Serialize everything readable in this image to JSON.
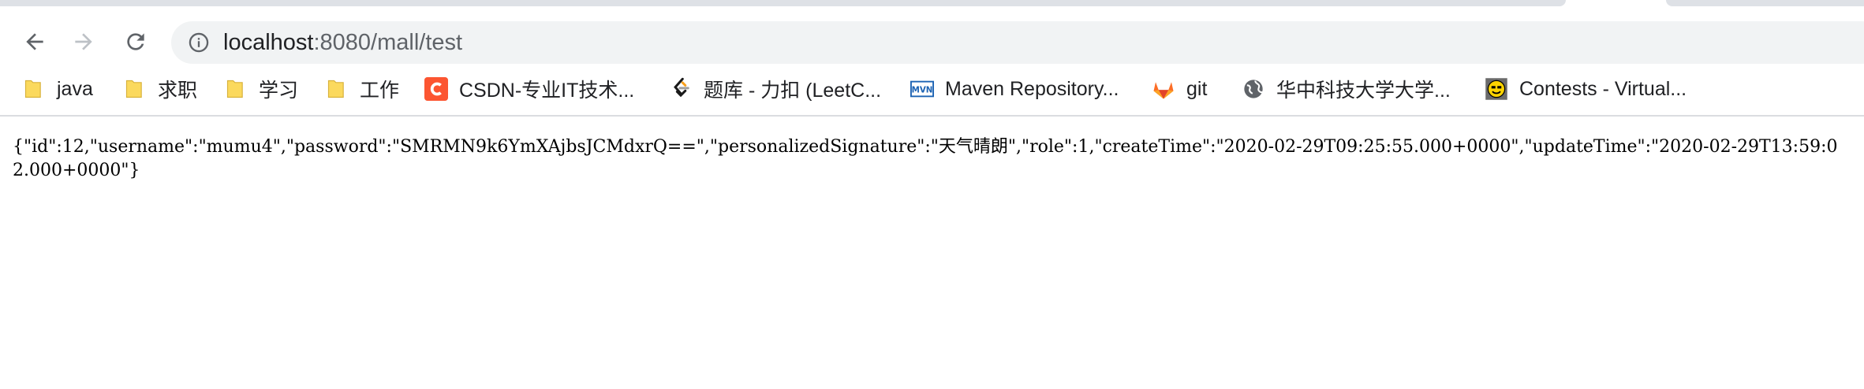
{
  "browser": {
    "url_host": "localhost",
    "url_rest": ":8080/mall/test"
  },
  "bookmarks": [
    {
      "label": "java",
      "icon": "folder-icon"
    },
    {
      "label": "求职",
      "icon": "folder-icon"
    },
    {
      "label": "学习",
      "icon": "folder-icon"
    },
    {
      "label": "工作",
      "icon": "folder-icon"
    },
    {
      "label": "CSDN-专业IT技术...",
      "icon": "csdn-icon"
    },
    {
      "label": "题库 - 力扣 (LeetC...",
      "icon": "leetcode-icon"
    },
    {
      "label": "Maven Repository...",
      "icon": "maven-icon"
    },
    {
      "label": "git",
      "icon": "gitlab-icon"
    },
    {
      "label": "华中科技大学大学...",
      "icon": "globe-icon"
    },
    {
      "label": "Contests - Virtual...",
      "icon": "smiley-icon"
    }
  ],
  "page": {
    "json_text": "{\"id\":12,\"username\":\"mumu4\",\"password\":\"SMRMN9k6YmXAjbsJCMdxrQ==\",\"personalizedSignature\":\"天气晴朗\",\"role\":1,\"createTime\":\"2020-02-29T09:25:55.000+0000\",\"updateTime\":\"2020-02-29T13:59:02.000+0000\"}"
  },
  "colors": {
    "folder": "#fbd95d",
    "csdn": "#fc5531",
    "maven": "#1b62b3",
    "gitlab": "#e24329",
    "icon_gray": "#5f6368"
  }
}
